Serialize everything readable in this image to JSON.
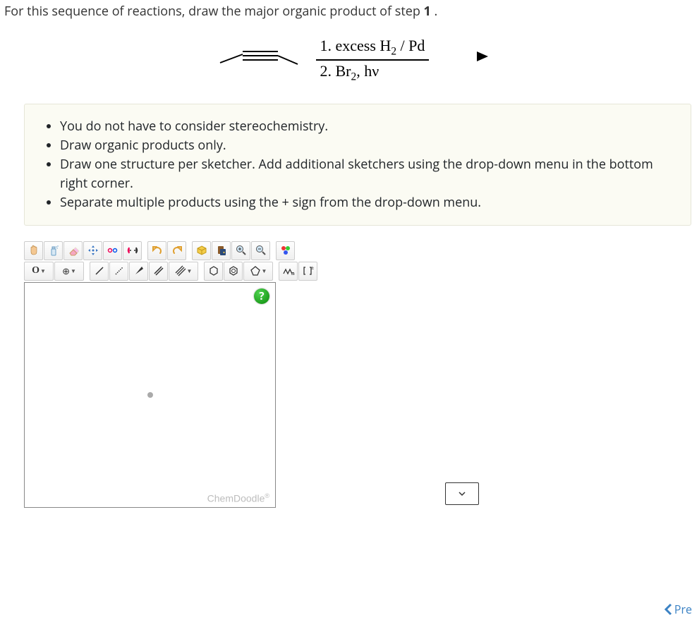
{
  "question": {
    "prefix": "For this sequence of reactions, draw the major organic product of step ",
    "step_number": "1",
    "suffix": " ."
  },
  "reaction": {
    "reagent_line1_prefix": "1. excess H",
    "reagent_line1_sub": "2",
    "reagent_line1_suffix": " / Pd",
    "reagent_line2_prefix": "2. Br",
    "reagent_line2_sub": "2",
    "reagent_line2_suffix": ", hν"
  },
  "instructions": {
    "items": [
      "You do not have to consider stereochemistry.",
      "Draw organic products only.",
      "Draw one structure per sketcher. Add additional sketchers using the drop-down menu in the bottom right corner.",
      "Separate multiple products using the + sign from the drop-down menu."
    ]
  },
  "toolbar1": {
    "hand": "hand-icon",
    "spray": "spray-icon",
    "eraser": "eraser-icon",
    "move": "move-icon",
    "rotate3d": "rotate3d-icon",
    "flip": "flip-icon",
    "undo": "undo-icon",
    "redo": "redo-icon",
    "cube": "cube-icon",
    "paste": "paste-icon",
    "zoom_in": "zoom-in-icon",
    "zoom_out": "zoom-out-icon",
    "color": "color-icon"
  },
  "toolbar2": {
    "atom_label": "O",
    "charge_label": "⊕",
    "bond_single": "single-bond-icon",
    "bond_dotted": "dotted-bond-icon",
    "bond_wedge": "wedge-bond-icon",
    "bond_double": "double-bond-icon",
    "bond_triple": "triple-bond-icon",
    "ring_cyclohex": "cyclohexane-icon",
    "ring_benzene": "benzene-icon",
    "ring_generic": "pentagon-icon",
    "chain": "chain-icon",
    "bracket": "bracket-icon"
  },
  "sketcher": {
    "help_label": "?",
    "brand_label": "ChemDoodle",
    "brand_reg": "®"
  },
  "nav": {
    "prev_label": "Pre"
  }
}
